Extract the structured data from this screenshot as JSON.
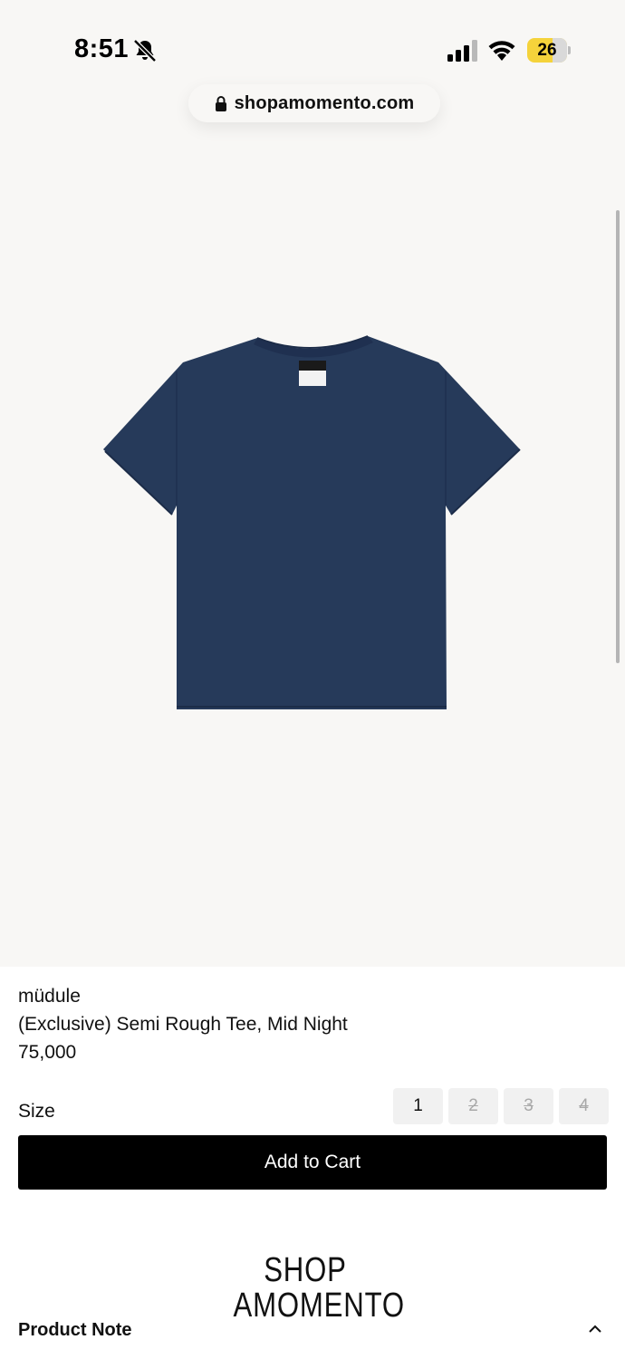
{
  "status_bar": {
    "time": "8:51",
    "battery": "26",
    "icons": [
      "bell-off-icon",
      "signal-icon",
      "wifi-icon",
      "battery-icon"
    ]
  },
  "browser": {
    "url": "shopamomento.com"
  },
  "product": {
    "brand": "müdule",
    "name": "(Exclusive) Semi Rough Tee, Mid Night",
    "price": "75,000",
    "image_color": "#263a5a",
    "size_label": "Size",
    "sizes": [
      {
        "label": "1",
        "available": true
      },
      {
        "label": "2",
        "available": false
      },
      {
        "label": "3",
        "available": false
      },
      {
        "label": "4",
        "available": false
      }
    ],
    "add_to_cart": "Add to Cart"
  },
  "footer": {
    "logo_line1": "SHOP",
    "logo_line2": "AMOMENTO",
    "product_note": "Product Note"
  },
  "colors": {
    "hero_bg": "#f8f7f5",
    "button_bg": "#000000",
    "battery": "#f5d33b"
  }
}
